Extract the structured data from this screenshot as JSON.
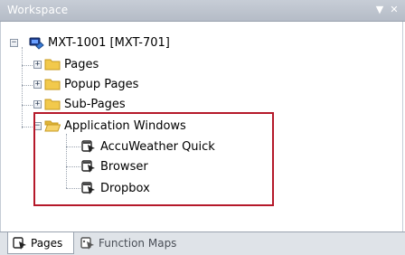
{
  "panel": {
    "title": "Workspace",
    "pin_icon": "dropdown-arrow-icon",
    "close_icon": "close-icon"
  },
  "tree": {
    "root": {
      "label": "MXT-1001 [MXT-701]",
      "icon": "device-icon",
      "expanded": true
    },
    "children": [
      {
        "label": "Pages",
        "icon": "folder-icon",
        "expanded": false
      },
      {
        "label": "Popup Pages",
        "icon": "folder-icon",
        "expanded": false
      },
      {
        "label": "Sub-Pages",
        "icon": "folder-icon",
        "expanded": false
      },
      {
        "label": "Application Windows",
        "icon": "folder-open-icon",
        "expanded": true,
        "children": [
          {
            "label": "AccuWeather Quick",
            "icon": "app-window-icon"
          },
          {
            "label": "Browser",
            "icon": "app-window-icon"
          },
          {
            "label": "Dropbox",
            "icon": "app-window-icon"
          }
        ]
      }
    ]
  },
  "tabs": [
    {
      "label": "Pages",
      "icon": "pages-icon",
      "active": true
    },
    {
      "label": "Function Maps",
      "icon": "function-maps-icon",
      "active": false
    }
  ],
  "colors": {
    "highlight_border": "#b5192a",
    "titlebar": "#bdc3cd",
    "folder": "#f2c94c"
  }
}
